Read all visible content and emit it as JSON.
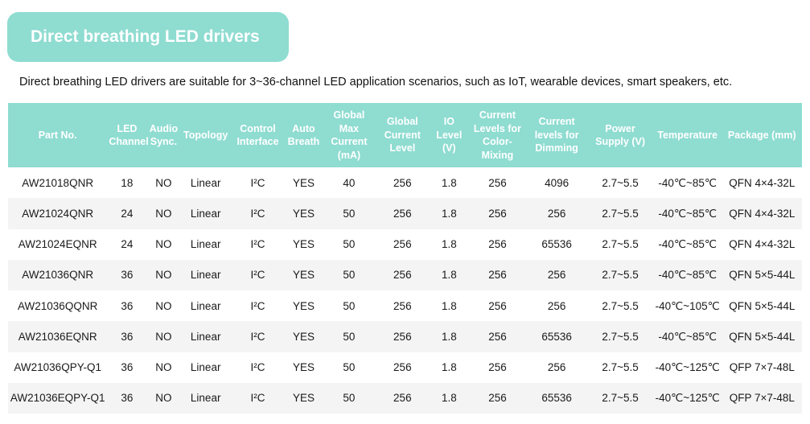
{
  "title": "Direct breathing LED drivers",
  "intro": "Direct breathing LED drivers are suitable for 3~36-channel LED application scenarios, such as IoT, wearable devices, smart speakers, etc.",
  "columns": [
    "Part No.",
    "LED Channel",
    "Audio Sync.",
    "Topology",
    "Control Interface",
    "Auto Breath",
    "Global Max Current (mA)",
    "Global Current Level",
    "IO Level (V)",
    "Current Levels for Color-Mixing",
    "Current levels for Dimming",
    "Power Supply (V)",
    "Temperature",
    "Package (mm)"
  ],
  "rows": [
    [
      "AW21018QNR",
      "18",
      "NO",
      "Linear",
      "I²C",
      "YES",
      "40",
      "256",
      "1.8",
      "256",
      "4096",
      "2.7~5.5",
      "-40℃~85℃",
      "QFN 4×4-32L"
    ],
    [
      "AW21024QNR",
      "24",
      "NO",
      "Linear",
      "I²C",
      "YES",
      "50",
      "256",
      "1.8",
      "256",
      "256",
      "2.7~5.5",
      "-40℃~85℃",
      "QFN 4×4-32L"
    ],
    [
      "AW21024EQNR",
      "24",
      "NO",
      "Linear",
      "I²C",
      "YES",
      "50",
      "256",
      "1.8",
      "256",
      "65536",
      "2.7~5.5",
      "-40℃~85℃",
      "QFN 4×4-32L"
    ],
    [
      "AW21036QNR",
      "36",
      "NO",
      "Linear",
      "I²C",
      "YES",
      "50",
      "256",
      "1.8",
      "256",
      "256",
      "2.7~5.5",
      "-40℃~85℃",
      "QFN 5×5-44L"
    ],
    [
      "AW21036QQNR",
      "36",
      "NO",
      "Linear",
      "I²C",
      "YES",
      "50",
      "256",
      "1.8",
      "256",
      "256",
      "2.7~5.5",
      "-40℃~105℃",
      "QFN 5×5-44L"
    ],
    [
      "AW21036EQNR",
      "36",
      "NO",
      "Linear",
      "I²C",
      "YES",
      "50",
      "256",
      "1.8",
      "256",
      "65536",
      "2.7~5.5",
      "-40℃~85℃",
      "QFN 5×5-44L"
    ],
    [
      "AW21036QPY-Q1",
      "36",
      "NO",
      "Linear",
      "I²C",
      "YES",
      "50",
      "256",
      "1.8",
      "256",
      "256",
      "2.7~5.5",
      "-40℃~125℃",
      "QFP 7×7-48L"
    ],
    [
      "AW21036EQPY-Q1",
      "36",
      "NO",
      "Linear",
      "I²C",
      "YES",
      "50",
      "256",
      "1.8",
      "256",
      "65536",
      "2.7~5.5",
      "-40℃~125℃",
      "QFP 7×7-48L"
    ]
  ],
  "colors": {
    "accent": "#8fdcd1",
    "header_text": "#ffffff",
    "stripe": "#f4f4f4"
  }
}
